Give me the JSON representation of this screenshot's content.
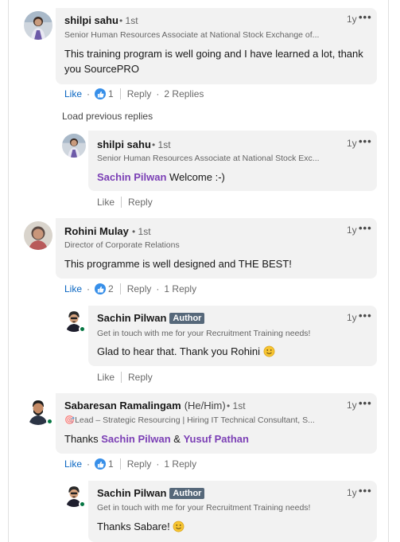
{
  "comments": [
    {
      "name": "shilpi sahu",
      "degree": "• 1st",
      "headline": "Senior Human Resources Associate at National Stock Exchange of...",
      "time": "1y",
      "text": "This training program is well going and I have learned a lot, thank you SourcePRO",
      "like_label": "Like",
      "like_count": "1",
      "reply_label": "Reply",
      "replies_label": "2 Replies"
    },
    {
      "name": "Rohini Mulay",
      "degree": "• 1st",
      "headline": "Director of Corporate Relations",
      "time": "1y",
      "text": "This programme is well designed and THE BEST!",
      "like_label": "Like",
      "like_count": "2",
      "reply_label": "Reply",
      "replies_label": "1 Reply"
    },
    {
      "name": "Sabaresan Ramalingam",
      "pronouns": "(He/Him)",
      "degree": "• 1st",
      "headline": "🎯Lead – Strategic Resourcing | Hiring IT Technical Consultant, S...",
      "time": "1y",
      "text_prefix": "Thanks ",
      "mention1": "Sachin Pilwan",
      "text_mid": " & ",
      "mention2": "Yusuf Pathan",
      "like_label": "Like",
      "like_count": "1",
      "reply_label": "Reply",
      "replies_label": "1 Reply"
    }
  ],
  "load_previous_label": "Load previous replies",
  "replies": [
    {
      "name": "shilpi sahu",
      "degree": "• 1st",
      "headline": "Senior Human Resources Associate at National Stock Exc...",
      "time": "1y",
      "mention": "Sachin Pilwan",
      "text": " Welcome :-)",
      "like_label": "Like",
      "reply_label": "Reply"
    },
    {
      "name": "Sachin Pilwan",
      "badge": "Author",
      "headline": "Get in touch with me for your Recruitment Training needs!",
      "time": "1y",
      "text": "Glad to hear that. Thank you Rohini ",
      "like_label": "Like",
      "reply_label": "Reply"
    },
    {
      "name": "Sachin Pilwan",
      "badge": "Author",
      "headline": "Get in touch with me for your Recruitment Training needs!",
      "time": "1y",
      "text": "Thanks Sabare! ",
      "like_label": "Like",
      "reply_label": "Reply"
    }
  ],
  "more_glyph": "•••",
  "colors": {
    "bubble": "#f2f2f2",
    "mention": "#7b3fb5",
    "like_active": "#0a66c2",
    "author_badge": "#56687a",
    "online": "#057642"
  }
}
